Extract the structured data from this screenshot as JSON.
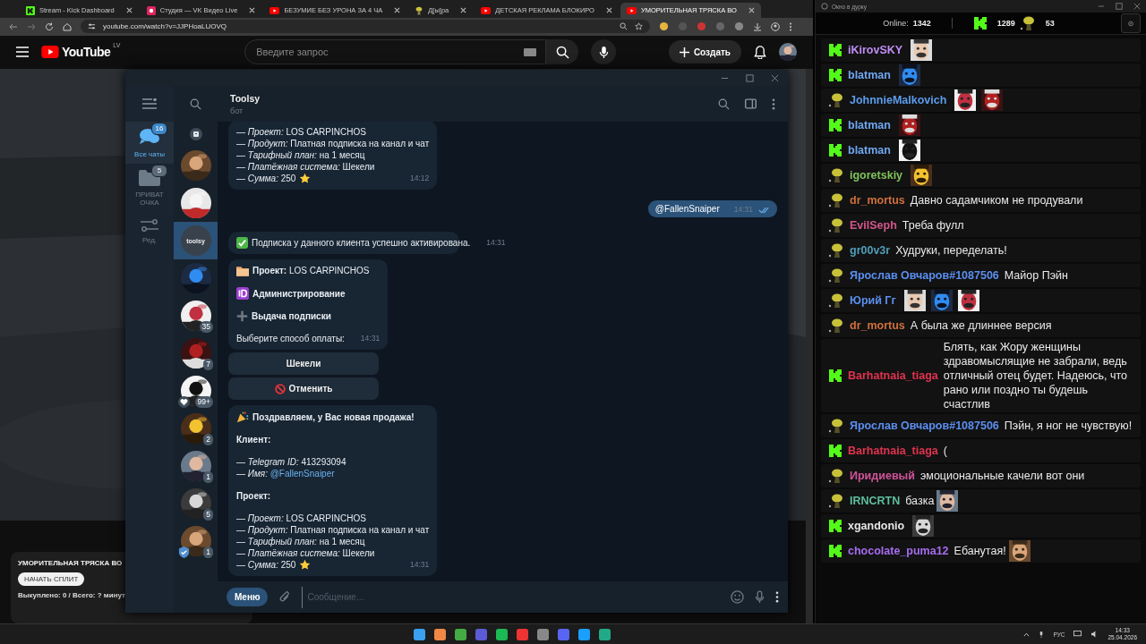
{
  "browser": {
    "tabs": [
      {
        "kind": "kick",
        "title": "Stream - Kick Dashboard",
        "selected": false
      },
      {
        "kind": "vk",
        "title": "Студия — VK Видео Live",
        "selected": false
      },
      {
        "kind": "youtube",
        "title": "БЕЗУМИЕ БЕЗ УРОНА ЗА 4 ЧА",
        "selected": false
      },
      {
        "kind": "mascot",
        "title": "Д[ы]ра",
        "selected": false
      },
      {
        "kind": "youtube",
        "title": "ДЕТСКАЯ РЕКЛАМА БЛОКИРО",
        "selected": false
      },
      {
        "kind": "youtube",
        "title": "УМОРИТЕЛЬНАЯ ТРЯСКА ВО",
        "selected": true
      }
    ],
    "address": "youtube.com/watch?v=JJPHoaLUOVQ"
  },
  "youtube": {
    "logo": "YouTube",
    "region": "LV",
    "search_placeholder": "Введите запрос",
    "create_button": "Создать",
    "stream_card": {
      "title": "УМОРИТЕЛЬНАЯ ТРЯСКА ВО",
      "button": "НАЧАТЬ СПЛИТ",
      "stats": "Выкуплено: 0 / Всего: ? минут"
    }
  },
  "telegram": {
    "folders": [
      {
        "kind": "chats",
        "label": "Все чаты",
        "badge": "16",
        "selected": true
      },
      {
        "kind": "folder",
        "label": "ПРИВАТ ОЧКА",
        "badge": "5",
        "selected": false
      },
      {
        "kind": "edit",
        "label": "Ред.",
        "selected": false
      }
    ],
    "chats": [
      {
        "kind": "archive",
        "selected": false
      },
      {
        "kind": "avatar",
        "selected": false
      },
      {
        "kind": "avatar",
        "selected": false
      },
      {
        "kind": "logo",
        "avatar_text": "toolsy",
        "selected": true
      },
      {
        "kind": "avatar",
        "selected": false
      },
      {
        "kind": "avatar",
        "badge": "35",
        "selected": false
      },
      {
        "kind": "avatar",
        "badge": "7",
        "selected": false
      },
      {
        "kind": "avatar-heart",
        "badge": "99+",
        "selected": false
      },
      {
        "kind": "avatar",
        "badge": "2",
        "selected": false
      },
      {
        "kind": "avatar",
        "badge": "1",
        "selected": false
      },
      {
        "kind": "avatar",
        "badge": "5",
        "selected": false
      },
      {
        "kind": "avatar-verified",
        "badge": "1",
        "selected": false
      }
    ],
    "header": {
      "title": "Toolsy",
      "subtitle": "бот"
    },
    "messages": [
      {
        "kind": "bot",
        "time": "14:12",
        "paragraphs": [
          [
            {
              "kind": "plain",
              "text": "— *Проект:* LOS CARPINCHOS"
            },
            {
              "kind": "plain",
              "text": "— *Продукт:* Платная подписка на канал и чат"
            },
            {
              "kind": "plain",
              "text": "— *Тарифный план:* на 1 месяц"
            },
            {
              "kind": "plain",
              "text": "— *Платёжная система:* Шекели"
            },
            {
              "kind": "amount",
              "text": "— *Сумма:* 250"
            }
          ]
        ]
      },
      {
        "kind": "outgoing",
        "text": "@FallenSnaiper",
        "time": "14:31",
        "read": true
      },
      {
        "kind": "bot",
        "time": "14:31",
        "paragraphs": [
          [
            {
              "kind": "check",
              "text": "Подписка у данного клиента успешно активирована."
            }
          ]
        ]
      },
      {
        "kind": "bot",
        "time": "14:31",
        "paragraphs": [
          [
            {
              "kind": "folder",
              "text": "**Проект:** LOS CARPINCHOS"
            }
          ],
          [
            {
              "kind": "id",
              "text": "Администрирование"
            }
          ],
          [
            {
              "kind": "plus",
              "text": "Выдача подписки"
            }
          ],
          [
            {
              "kind": "plain",
              "text": "Выберите способ оплаты:"
            }
          ]
        ],
        "keyboard": [
          {
            "kind": "option",
            "label": "Шекели"
          },
          {
            "kind": "cancel",
            "label": "Отменить"
          }
        ]
      },
      {
        "kind": "bot",
        "time": "14:31",
        "paragraphs": [
          [
            {
              "kind": "party",
              "text": "Поздравляем, у Вас новая продажа!"
            }
          ],
          [
            {
              "kind": "bold",
              "text": "Клиент:"
            }
          ],
          [
            {
              "kind": "plain",
              "text": "— *Telegram ID:* 413293094"
            },
            {
              "kind": "link",
              "text": "— *Имя:*",
              "link": "@FallenSnaiper"
            }
          ],
          [
            {
              "kind": "bold",
              "text": "Проект:"
            }
          ],
          [
            {
              "kind": "plain",
              "text": "— *Проект:* LOS CARPINCHOS"
            },
            {
              "kind": "plain",
              "text": "— *Продукт:* Платная подписка на канал и чат"
            },
            {
              "kind": "plain",
              "text": "— *Тарифный план:* на 1 месяц"
            },
            {
              "kind": "plain",
              "text": "— *Платёжная система:* Шекели"
            },
            {
              "kind": "amount",
              "text": "— *Сумма:* 250"
            }
          ]
        ]
      }
    ],
    "composer": {
      "menu_button": "Меню",
      "placeholder": "Сообщение..."
    }
  },
  "chat_window": {
    "title": "Окно в дурку",
    "online_label": "Online:",
    "online": "1342",
    "kick_count": "1289",
    "other_count": "53",
    "messages": [
      {
        "kind": "kick",
        "user": "iKirovSKY",
        "color": "#c08ef5"
      },
      {
        "kind": "kick",
        "user": "blatman",
        "color": "#6ea6f0"
      },
      {
        "kind": "mascot",
        "user": "JohnnieMalkovich",
        "color": "#5b9ded"
      },
      {
        "kind": "kick",
        "user": "blatman",
        "color": "#6ea6f0"
      },
      {
        "kind": "kick",
        "user": "blatman",
        "color": "#6ea6f0"
      },
      {
        "kind": "mascot",
        "user": "igoretskiy",
        "color": "#7fc35a"
      },
      {
        "kind": "mascot",
        "user": "dr_mortus",
        "color": "#d0703c",
        "text": "Давно садамчиком не продували"
      },
      {
        "kind": "mascot",
        "user": "EvilSeph",
        "color": "#d2578c",
        "text": "Треба фулл"
      },
      {
        "kind": "mascot",
        "user": "gr00v3r",
        "color": "#4f9fb8",
        "text": "Худруки, переделать!"
      },
      {
        "kind": "mascot",
        "user": "Ярослав Овчаров#1087506",
        "color": "#5b8ff0",
        "text": "Майор Пэйн"
      },
      {
        "kind": "mascot",
        "user": "Юрий Гг",
        "color": "#5b8ff0"
      },
      {
        "kind": "mascot",
        "user": "dr_mortus",
        "color": "#d0703c",
        "text": "А была же длиннее версия"
      },
      {
        "kind": "kick",
        "user": "Barhatnaia_tiaga",
        "color": "#e0334f",
        "text": "Блять, как Жору женщины здравомыслящие не забрали, ведь отличный отец будет. Надеюсь, что рано или поздно ты будешь счастлив"
      },
      {
        "kind": "mascot",
        "user": "Ярослав Овчаров#1087506",
        "color": "#5b8ff0",
        "text": "Пэйн, я ног не чувствую!"
      },
      {
        "kind": "kick",
        "user": "Barhatnaia_tiaga",
        "color": "#e0334f",
        "text": "("
      },
      {
        "kind": "mascot",
        "user": "Иридиевый",
        "color": "#d0549a",
        "text": "эмоциональные качели вот они"
      },
      {
        "kind": "mascot",
        "user": "IRNCRTN",
        "color": "#5fbf9f",
        "text": "базка"
      },
      {
        "kind": "kick",
        "user": "xgandonio",
        "color": "#e6e6e6"
      },
      {
        "kind": "kick",
        "user": "chocolate_puma12",
        "color": "#a66cf0",
        "text": "Ебанутая!"
      }
    ]
  },
  "taskbar": {
    "language": "РУС",
    "time": "14:33",
    "date": "25.04.2026"
  }
}
